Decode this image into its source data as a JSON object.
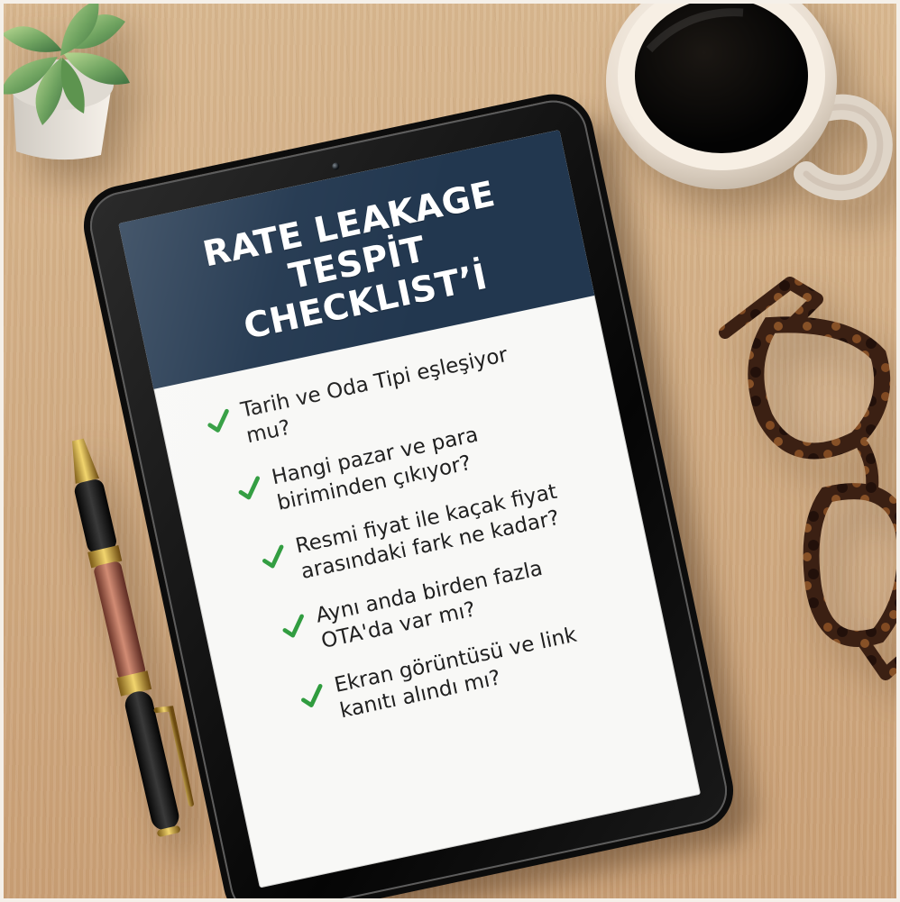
{
  "tablet": {
    "title_line_1": "RATE LEAKAGE TESPİT",
    "title_line_2": "CHECKLIST’İ",
    "checklist": [
      {
        "icon": "check-icon",
        "text": "Tarih ve Oda Tipi eşleşiyor mu?"
      },
      {
        "icon": "check-icon",
        "text": "Hangi pazar ve para biriminden çıkıyor?"
      },
      {
        "icon": "check-icon",
        "text": "Resmi fiyat ile kaçak fiyat arasındaki fark ne kadar?"
      },
      {
        "icon": "check-icon",
        "text": "Aynı anda birden fazla OTA'da var mı?"
      },
      {
        "icon": "check-icon",
        "text": "Ekran görüntüsü ve link kanıtı alındı mı?"
      }
    ]
  },
  "colors": {
    "desk": "#c99f75",
    "header": "#22374f",
    "screen": "#f8f8f6",
    "check": "#2f9c3e",
    "coffee": "#050505",
    "mug": "#e8ddd0"
  },
  "objects": {
    "plant_icon": "succulent-icon",
    "cup_icon": "coffee-cup-icon",
    "glasses_icon": "eyeglasses-icon",
    "pen_icon": "pen-icon",
    "tablet_icon": "tablet-icon"
  }
}
